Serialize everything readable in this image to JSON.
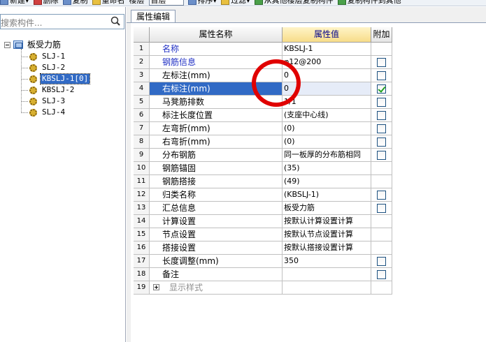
{
  "toolbar": {
    "items": [
      {
        "label": "新建",
        "icon": "new-icon"
      },
      {
        "label": "删除",
        "icon": "delete-icon"
      },
      {
        "label": "复制",
        "icon": "copy-icon"
      },
      {
        "label": "重命名",
        "icon": "rename-icon"
      },
      {
        "label": "楼层",
        "icon": ""
      }
    ],
    "floor_value": "首层",
    "sort_label": "排序",
    "filter_label": "过滤",
    "copy_from_label": "从其他楼层复制构件",
    "copy_to_label": "复制构件到其他"
  },
  "left": {
    "search_placeholder": "搜索构件...",
    "tree": {
      "root_label": "板受力筋",
      "children": [
        "SLJ-1",
        "SLJ-2",
        "KBSLJ-1[0]",
        "KBSLJ-2",
        "SLJ-3",
        "SLJ-4"
      ],
      "selected_index": 2
    }
  },
  "right": {
    "tab_label": "属性编辑",
    "columns": [
      "属性名称",
      "属性值",
      "附加"
    ],
    "rows": [
      {
        "num": "1",
        "name": "名称",
        "value": "KBSLJ-1",
        "checkbox": null,
        "style": "blue"
      },
      {
        "num": "2",
        "name": "钢筋信息",
        "value": "φ12@200",
        "checkbox": false,
        "style": "blue"
      },
      {
        "num": "3",
        "name": "左标注(mm)",
        "value": "0",
        "checkbox": false,
        "style": ""
      },
      {
        "num": "4",
        "name": "右标注(mm)",
        "value": "0",
        "checkbox": true,
        "style": "selected"
      },
      {
        "num": "5",
        "name": "马凳筋排数",
        "value": "1/1",
        "checkbox": false,
        "style": ""
      },
      {
        "num": "6",
        "name": "标注长度位置",
        "value": "(支座中心线)",
        "checkbox": false,
        "style": ""
      },
      {
        "num": "7",
        "name": "左弯折(mm)",
        "value": "(0)",
        "checkbox": false,
        "style": ""
      },
      {
        "num": "8",
        "name": "右弯折(mm)",
        "value": "(0)",
        "checkbox": false,
        "style": ""
      },
      {
        "num": "9",
        "name": "分布钢筋",
        "value": "同一板厚的分布筋相同",
        "checkbox": false,
        "style": ""
      },
      {
        "num": "10",
        "name": "钢筋锚固",
        "value": "(35)",
        "checkbox": null,
        "style": ""
      },
      {
        "num": "11",
        "name": "钢筋搭接",
        "value": "(49)",
        "checkbox": null,
        "style": ""
      },
      {
        "num": "12",
        "name": "归类名称",
        "value": "(KBSLJ-1)",
        "checkbox": false,
        "style": ""
      },
      {
        "num": "13",
        "name": "汇总信息",
        "value": "板受力筋",
        "checkbox": false,
        "style": ""
      },
      {
        "num": "14",
        "name": "计算设置",
        "value": "按默认计算设置计算",
        "checkbox": null,
        "style": ""
      },
      {
        "num": "15",
        "name": "节点设置",
        "value": "按默认节点设置计算",
        "checkbox": null,
        "style": ""
      },
      {
        "num": "16",
        "name": "搭接设置",
        "value": "按默认搭接设置计算",
        "checkbox": null,
        "style": ""
      },
      {
        "num": "17",
        "name": "长度调整(mm)",
        "value": "350",
        "checkbox": false,
        "style": ""
      },
      {
        "num": "18",
        "name": "备注",
        "value": "",
        "checkbox": false,
        "style": ""
      },
      {
        "num": "19",
        "name": "显示样式",
        "value": "",
        "checkbox": null,
        "style": "gray"
      }
    ]
  },
  "colors": {
    "selection": "#316ac5",
    "header_value_bg": "#f7dc88",
    "annotation": "#e00000",
    "link_blue": "#1f2fc4"
  }
}
